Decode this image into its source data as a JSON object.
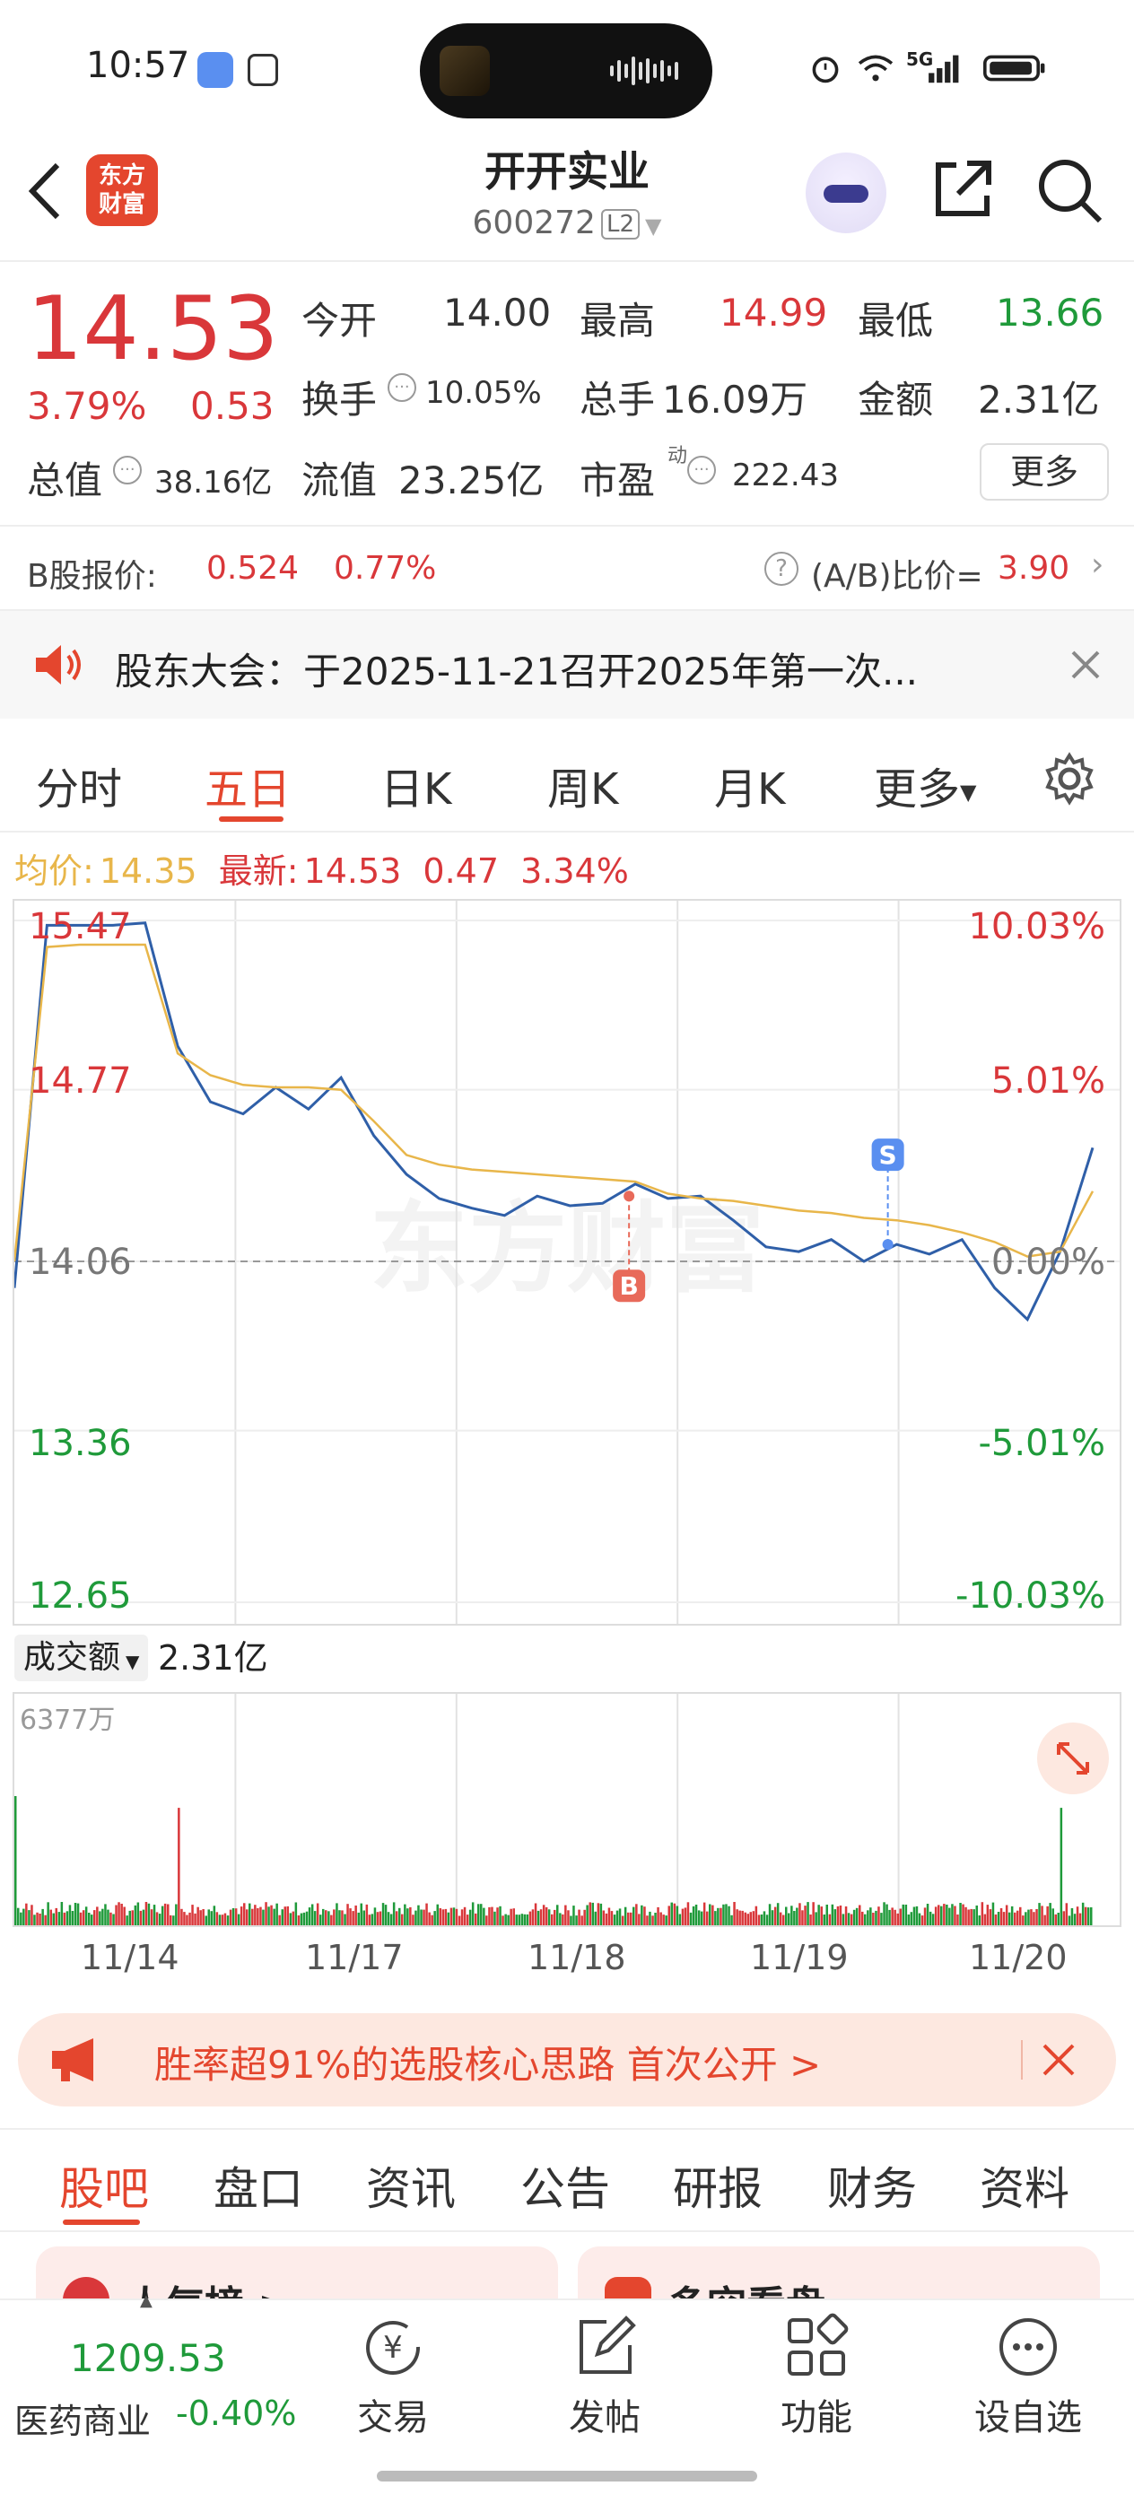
{
  "status_bar": {
    "time": "10:57",
    "network": "5G"
  },
  "header": {
    "stock_name": "开开实业",
    "stock_code": "600272",
    "level_badge": "L2",
    "logo_text_1": "东方",
    "logo_text_2": "财富"
  },
  "quote": {
    "price": "14.53",
    "change_pct": "3.79%",
    "change": "0.53",
    "open_label": "今开",
    "open": "14.00",
    "high_label": "最高",
    "high": "14.99",
    "low_label": "最低",
    "low": "13.66",
    "turnover_label": "换手",
    "turnover": "10.05%",
    "volume_label": "总手",
    "volume": "16.09万",
    "amount_label": "金额",
    "amount": "2.31亿",
    "mcap_label": "总值",
    "mcap": "38.16亿",
    "float_label": "流值",
    "float_cap": "23.25亿",
    "pe_label": "市盈",
    "pe_super": "动",
    "pe": "222.43",
    "more_label": "更多"
  },
  "b_share": {
    "label": "B股报价:",
    "price": "0.524",
    "pct": "0.77%",
    "ratio_label": "(A/B)比价=",
    "ratio": "3.90"
  },
  "notice": {
    "text": "股东大会：于2025-11-21召开2025年第一次..."
  },
  "chart_tabs": [
    {
      "label": "分时"
    },
    {
      "label": "五日"
    },
    {
      "label": "日K"
    },
    {
      "label": "周K"
    },
    {
      "label": "月K"
    },
    {
      "label": "更多"
    }
  ],
  "chart_info": {
    "avg_label": "均价:",
    "avg": "14.35",
    "latest_label": "最新:",
    "latest": "14.53",
    "chg": "0.47",
    "pct": "3.34%"
  },
  "chart_data": {
    "type": "line",
    "y_left_ticks": [
      "15.47",
      "14.77",
      "14.06",
      "13.36",
      "12.65"
    ],
    "y_right_ticks": [
      "10.03%",
      "5.01%",
      "0.00%",
      "-5.01%",
      "-10.03%"
    ],
    "ylim": [
      12.65,
      15.47
    ],
    "baseline": 14.06,
    "x_labels": [
      "11/14",
      "11/17",
      "11/18",
      "11/19",
      "11/20"
    ],
    "series": [
      {
        "values": [
          13.95,
          15.45,
          15.45,
          15.45,
          15.46,
          14.95,
          14.72,
          14.67,
          14.78,
          14.69,
          14.82,
          14.58,
          14.42,
          14.32,
          14.28,
          14.25,
          14.33,
          14.29,
          14.3,
          14.38,
          14.32,
          14.33,
          14.23,
          14.12,
          14.1,
          14.15,
          14.06,
          14.13,
          14.09,
          14.15,
          13.95,
          13.82,
          14.1,
          14.53
        ]
      },
      {
        "values": [
          14.06,
          15.36,
          15.37,
          15.37,
          15.37,
          14.92,
          14.83,
          14.79,
          14.78,
          14.78,
          14.77,
          14.64,
          14.5,
          14.46,
          14.44,
          14.43,
          14.42,
          14.41,
          14.4,
          14.39,
          14.34,
          14.32,
          14.31,
          14.29,
          14.27,
          14.26,
          14.24,
          14.23,
          14.21,
          14.18,
          14.14,
          14.08,
          14.1,
          14.35
        ]
      }
    ],
    "markers": [
      {
        "label": "B",
        "price": 14.33
      },
      {
        "label": "S",
        "price": 14.13
      }
    ],
    "volume": {
      "label": "成交额",
      "total": "2.31亿",
      "max_label": "6377万"
    }
  },
  "banner": {
    "text": "胜率超91%的选股核心思路 首次公开 >"
  },
  "bottom_tabs": [
    {
      "label": "股吧"
    },
    {
      "label": "盘口"
    },
    {
      "label": "资讯"
    },
    {
      "label": "公告"
    },
    {
      "label": "研报"
    },
    {
      "label": "财务"
    },
    {
      "label": "资料"
    }
  ],
  "section_cards": [
    {
      "label": "人气榜 >"
    },
    {
      "label": "多空看盘"
    }
  ],
  "index_widget": {
    "value": "1209.53",
    "name": "医药商业",
    "pct": "-0.40%"
  },
  "nav": [
    {
      "label": "交易",
      "glyph": "¥"
    },
    {
      "label": "发帖"
    },
    {
      "label": "功能"
    },
    {
      "label": "设自选"
    }
  ],
  "colors": {
    "up": "#d9373a",
    "down": "#1f9a3a",
    "accent": "#e4462e",
    "line": "#2f5fa8",
    "avg": "#e8b64a"
  }
}
